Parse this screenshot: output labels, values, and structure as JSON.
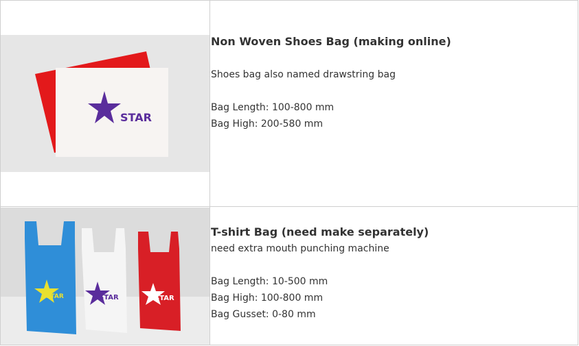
{
  "rows": [
    {
      "image": {
        "icon": "shoes-bag-photo",
        "logo_text": "STAR",
        "colors": {
          "bg": "#e9e9e9",
          "red": "#e3191b",
          "bag": "#f7f4f2",
          "logo": "#5a2d9c"
        }
      },
      "title": "Non Woven Shoes Bag (making online)",
      "lines": [
        "Shoes bag also named drawstring bag",
        "",
        "Bag Length: 100-800 mm",
        "Bag High: 200-580 mm"
      ]
    },
    {
      "image": {
        "icon": "tshirt-bags-photo",
        "logo_text": "STAR",
        "colors": {
          "blue": "#2f8ed8",
          "white": "#f5f5f5",
          "red": "#d81f26",
          "logo_blue": "#e8e030",
          "logo_white": "#5a2d9c",
          "logo_red": "#ffffff"
        }
      },
      "title": "T-shirt Bag (need make separately)",
      "lines": [
        "need extra mouth punching machine",
        "",
        "Bag Length: 10-500 mm",
        "Bag High: 100-800 mm",
        "Bag Gusset: 0-80 mm"
      ]
    }
  ]
}
